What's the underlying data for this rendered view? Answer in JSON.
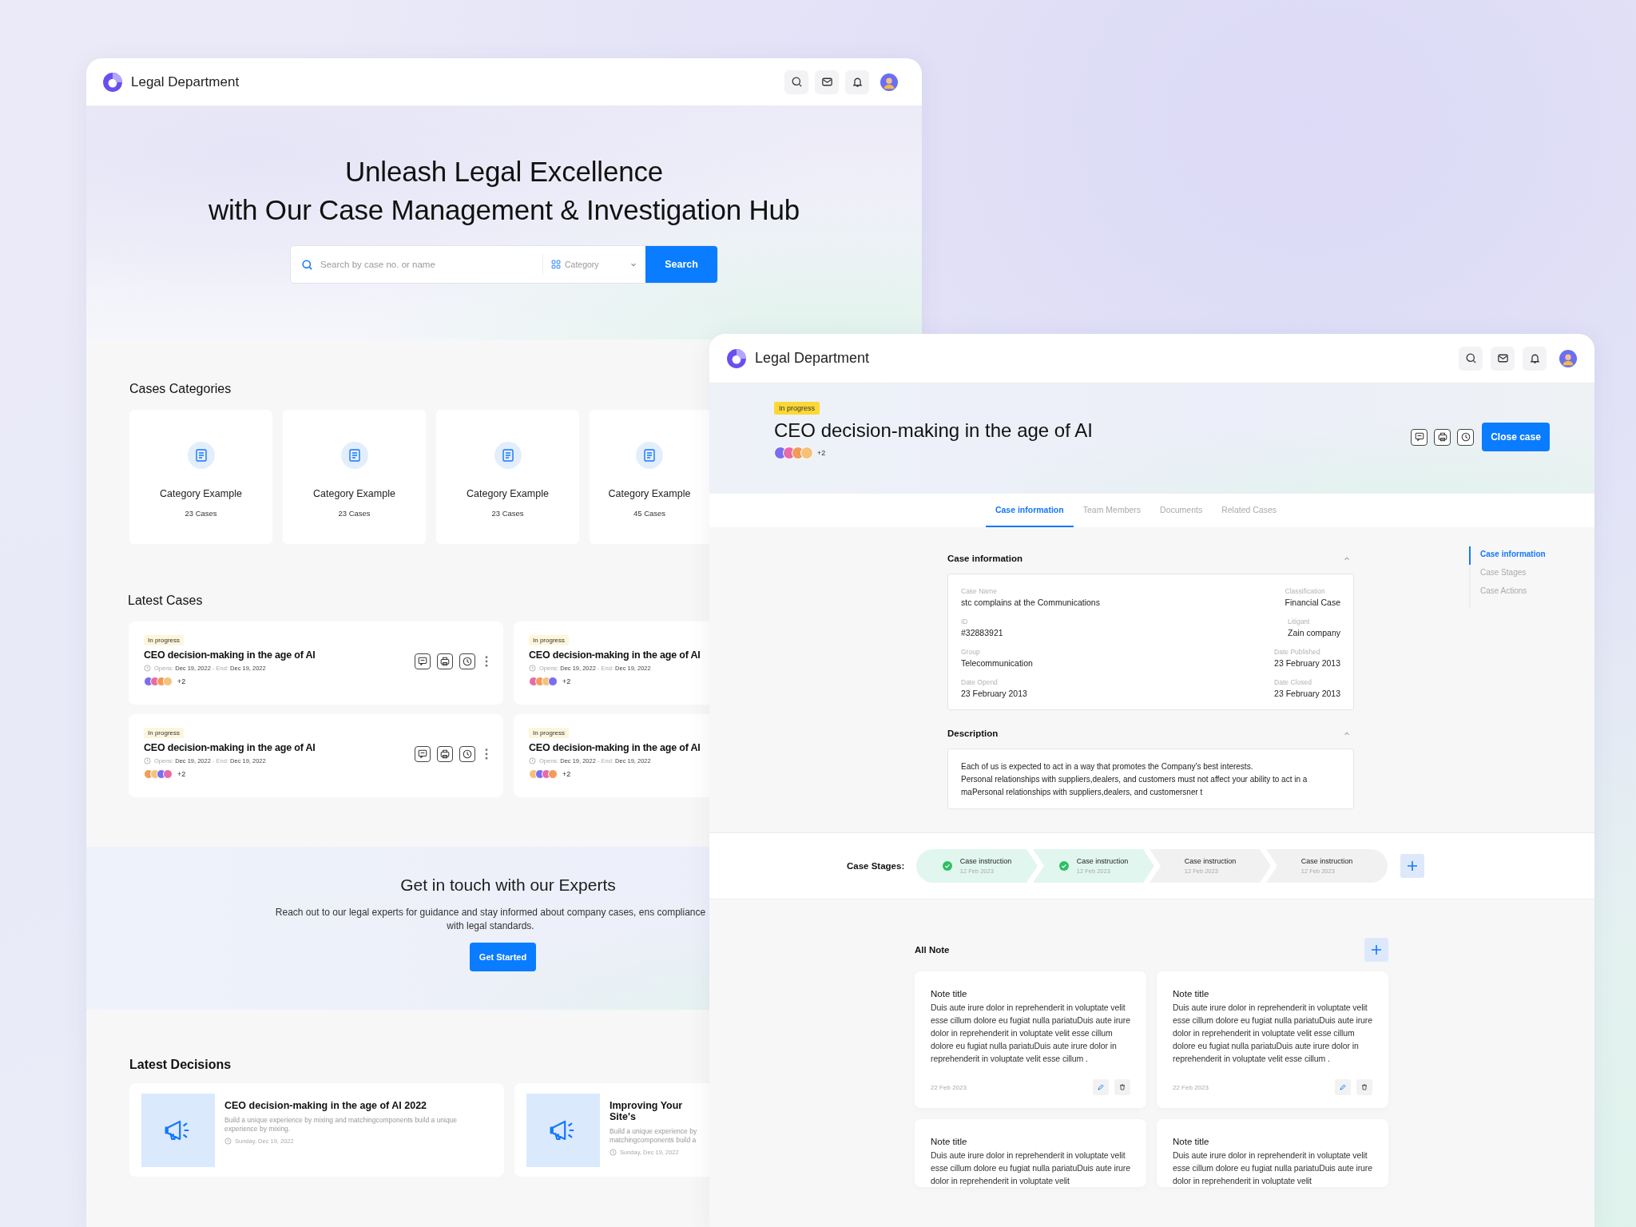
{
  "left_window": {
    "header": {
      "title": "Legal Department"
    },
    "hero": {
      "title_lines": [
        "Unleash Legal Excellence",
        "with Our Case Management & Investigation Hub"
      ],
      "search": {
        "placeholder": "Search by case no. or name",
        "category": "Category",
        "button": "Search"
      }
    },
    "categories": {
      "title": "Cases Categories",
      "items": [
        {
          "name": "Category Example",
          "count": "23 Cases"
        },
        {
          "name": "Category Example",
          "count": "23 Cases"
        },
        {
          "name": "Category Example",
          "count": "23 Cases"
        },
        {
          "name": "Category Example",
          "count": "45 Cases"
        }
      ]
    },
    "latest_cases": {
      "title": "Latest Cases",
      "items": [
        {
          "status": "In progress",
          "title": "CEO decision-making in the age of AI",
          "opens_label": "Opens:",
          "opens": "Dec 19, 2022",
          "separator": "-",
          "end_label": "End:",
          "end": "Dec 19, 2022",
          "extra": "+2",
          "actions_visible": true
        },
        {
          "status": "In progress",
          "title": "CEO decision-making in the age of AI",
          "opens_label": "Opens:",
          "opens": "Dec 19, 2022",
          "separator": "-",
          "end_label": "End:",
          "end": "Dec 19, 2022",
          "extra": "+2",
          "actions_visible": false
        },
        {
          "status": "In progress",
          "title": "CEO decision-making in the age of AI",
          "opens_label": "Opens:",
          "opens": "Dec 19, 2022",
          "separator": "-",
          "end_label": "End:",
          "end": "Dec 19, 2022",
          "extra": "+2",
          "actions_visible": true
        },
        {
          "status": "In progress",
          "title": "CEO decision-making in the age of AI",
          "opens_label": "Opens:",
          "opens": "Dec 19, 2022",
          "separator": "-",
          "end_label": "End:",
          "end": "Dec 19, 2022",
          "extra": "+2",
          "actions_visible": false
        }
      ]
    },
    "contact": {
      "title": "Get in touch with our Experts",
      "text": "Reach out to our legal experts for guidance and stay informed about company cases, ens compliance with legal standards.",
      "button": "Get Started"
    },
    "decisions": {
      "title": "Latest Decisions",
      "items": [
        {
          "title": "CEO decision-making in the age of AI 2022",
          "text": "Build a unique experience by mixing and matchingcomponents build a unique experience by mixing.",
          "date": "Sunday, Dec 19, 2022"
        },
        {
          "title": "Improving Your Site's",
          "text": "Build a unique experience by matchingcomponents build a",
          "date": "Sunday, Dec 19, 2022"
        }
      ]
    }
  },
  "right_window": {
    "header": {
      "title": "Legal Department"
    },
    "case": {
      "status": "In progress",
      "title": "CEO decision-making in the age of AI",
      "extra": "+2",
      "close_button": "Close case"
    },
    "tabs": [
      {
        "label": "Case information",
        "selected": true
      },
      {
        "label": "Team Members",
        "selected": false
      },
      {
        "label": "Documents",
        "selected": false
      },
      {
        "label": "Related Cases",
        "selected": false
      }
    ],
    "info": {
      "title": "Case information",
      "expanded": true,
      "fields": [
        {
          "label": "Case Name",
          "value": "stc complains at the Communications"
        },
        {
          "label": "Classification",
          "value": "Financial Case"
        },
        {
          "label": "ID",
          "value": "#32883921"
        },
        {
          "label": "Litigant",
          "value": "Zain company"
        },
        {
          "label": "Group",
          "value": "Telecommunication"
        },
        {
          "label": "Date Published",
          "value": "23 February 2013"
        },
        {
          "label": "Date Opend",
          "value": "23 February 2013"
        },
        {
          "label": "Date Closed",
          "value": "23 February 2013"
        }
      ]
    },
    "description": {
      "title": "Description",
      "expanded": true,
      "text": "Each of us is expected to act in a way that promotes the Company's best interests.\nPersonal relationships with suppliers,dealers, and customers must not affect your ability to act in a maPersonal relationships with suppliers,dealers, and customersner t"
    },
    "side_nav": [
      {
        "label": "Case information",
        "selected": true
      },
      {
        "label": "Case Stages",
        "selected": false
      },
      {
        "label": "Case Actions",
        "selected": false
      }
    ],
    "stages": {
      "label": "Case Stages:",
      "items": [
        {
          "title": "Case instruction",
          "date": "12 Feb 2023",
          "done": true
        },
        {
          "title": "Case instruction",
          "date": "12 Feb 2023",
          "done": true
        },
        {
          "title": "Case instruction",
          "date": "12 Feb 2023",
          "done": false
        },
        {
          "title": "Case instruction",
          "date": "12 Feb 2023",
          "done": false
        }
      ]
    },
    "notes": {
      "title": "All Note",
      "items": [
        {
          "title": "Note title",
          "text": "Duis aute irure dolor in reprehenderit in voluptate velit esse cillum dolore eu fugiat nulla pariatuDuis aute irure dolor in reprehenderit in voluptate velit esse cillum dolore eu fugiat nulla pariatuDuis aute irure dolor in reprehenderit in voluptate velit esse cillum .",
          "date": "22 Feb 2023"
        },
        {
          "title": "Note title",
          "text": "Duis aute irure dolor in reprehenderit in voluptate velit esse cillum dolore eu fugiat nulla pariatuDuis aute irure dolor in reprehenderit in voluptate velit esse cillum dolore eu fugiat nulla pariatuDuis aute irure dolor in reprehenderit in voluptate velit esse cillum .",
          "date": "22 Feb 2023"
        },
        {
          "title": "Note title",
          "text": "Duis aute irure dolor in reprehenderit in voluptate velit esse cillum dolore eu fugiat nulla pariatuDuis aute irure dolor in reprehenderit in voluptate velit"
        },
        {
          "title": "Note title",
          "text": "Duis aute irure dolor in reprehenderit in voluptate velit esse cillum dolore eu fugiat nulla pariatuDuis aute irure dolor in reprehenderit in voluptate velit"
        }
      ]
    }
  }
}
